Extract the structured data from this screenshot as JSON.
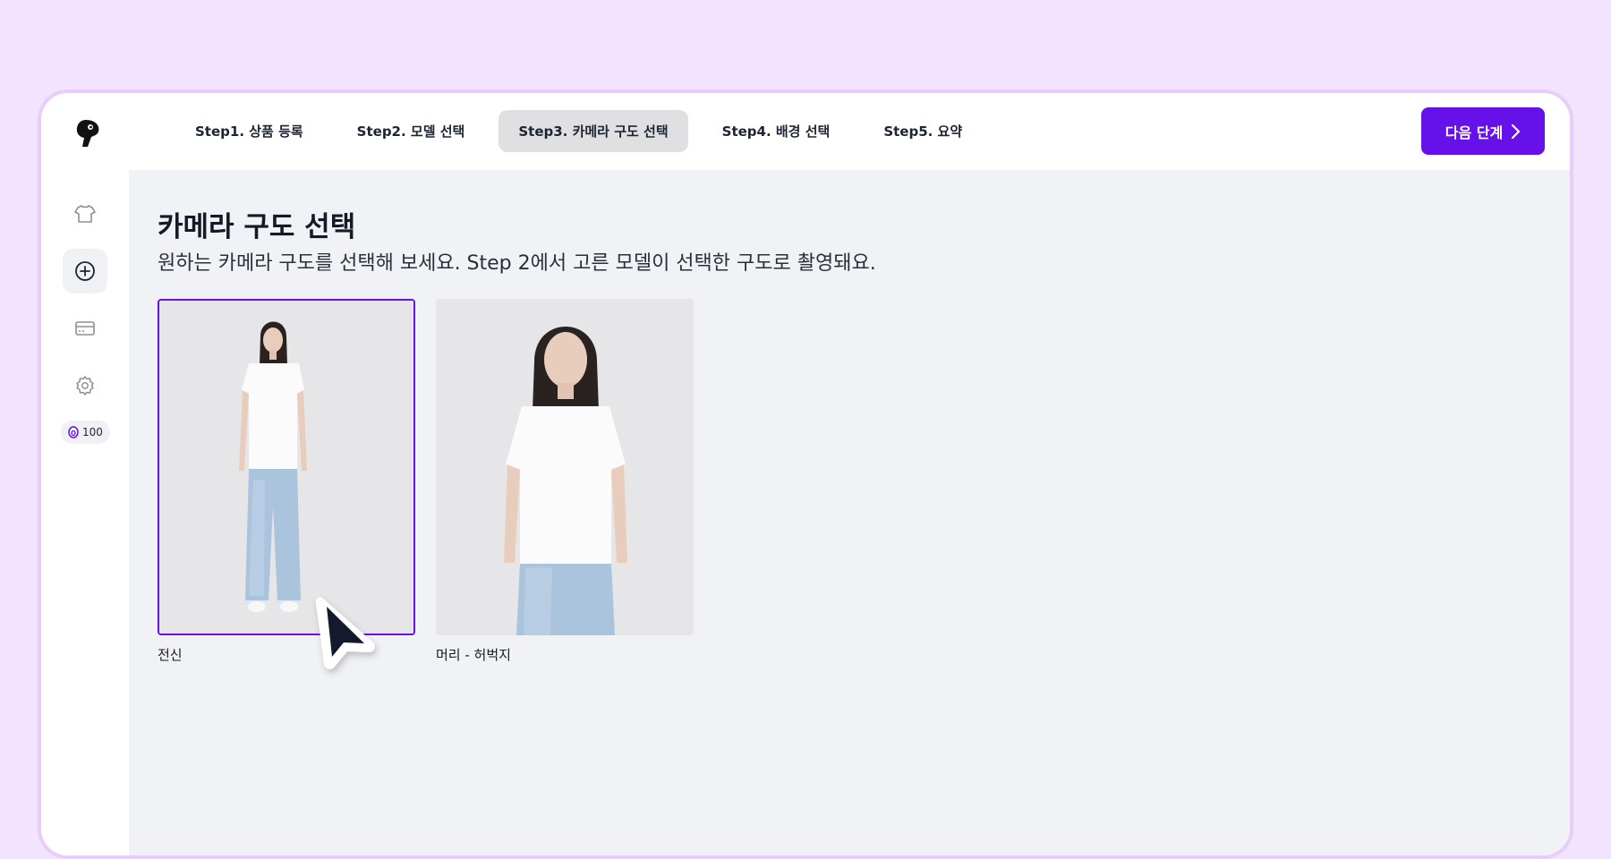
{
  "steps": [
    {
      "label": "Step1. 상품 등록"
    },
    {
      "label": "Step2. 모델 선택"
    },
    {
      "label": "Step3. 카메라 구도 선택"
    },
    {
      "label": "Step4. 배경 선택"
    },
    {
      "label": "Step5. 요약"
    }
  ],
  "active_step": 2,
  "next_button": {
    "label": "다음 단계"
  },
  "sidebar": {
    "items": [
      {
        "icon": "tshirt-icon"
      },
      {
        "icon": "plus-circle-icon",
        "active": true
      },
      {
        "icon": "credit-card-icon"
      },
      {
        "icon": "gear-icon"
      }
    ],
    "credit": "100"
  },
  "main": {
    "title": "카메라 구도 선택",
    "subtitle": "원하는 카메라 구도를 선택해 보세요. Step 2에서 고른 모델이 선택한 구도로 촬영돼요.",
    "options": [
      {
        "label": "전신",
        "selected": true
      },
      {
        "label": "머리 - 허벅지",
        "selected": false
      }
    ]
  },
  "colors": {
    "accent": "#6610ea",
    "background": "#f2e3fe",
    "content_bg": "#f1f2f5"
  }
}
